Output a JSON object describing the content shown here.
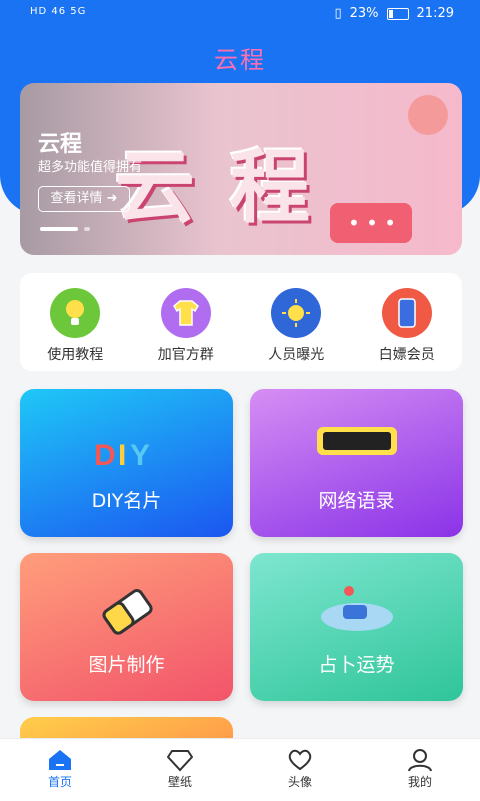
{
  "statusbar": {
    "left": "HD 46 5G",
    "battery": "23%",
    "time": "21:29"
  },
  "app_title": "云程",
  "banner": {
    "title": "云程",
    "subtitle": "超多功能值得拥有",
    "button": "查看详情 ➜",
    "big_text": "云程"
  },
  "quick_actions": [
    {
      "label": "使用教程"
    },
    {
      "label": "加官方群"
    },
    {
      "label": "人员曝光"
    },
    {
      "label": "白嫖会员"
    }
  ],
  "cards": [
    {
      "label": "DIY名片"
    },
    {
      "label": "网络语录"
    },
    {
      "label": "图片制作"
    },
    {
      "label": "占卜运势"
    }
  ],
  "tabs": [
    {
      "label": "首页"
    },
    {
      "label": "壁纸"
    },
    {
      "label": "头像"
    },
    {
      "label": "我的"
    }
  ],
  "colors": {
    "primary": "#1a73f3",
    "title_pink": "#ff6fb0"
  }
}
